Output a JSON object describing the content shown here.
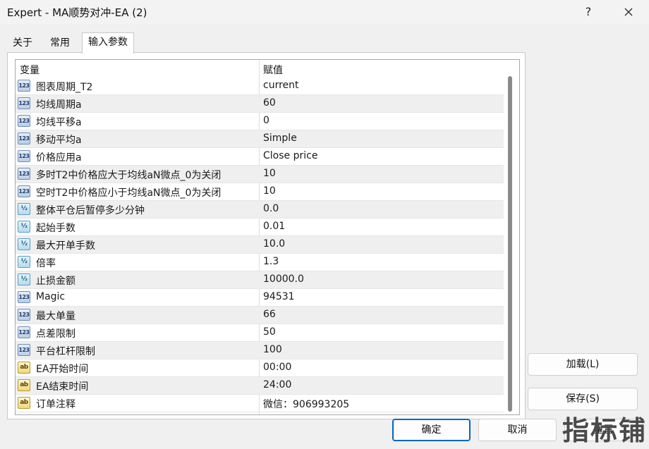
{
  "window": {
    "title": "Expert - MA顺势对冲-EA (2)",
    "help_label": "?"
  },
  "tabs": [
    {
      "label": "关于",
      "active": false
    },
    {
      "label": "常用",
      "active": false
    },
    {
      "label": "输入参数",
      "active": true
    }
  ],
  "table": {
    "headers": {
      "variable": "变量",
      "value": "赋值"
    },
    "rows": [
      {
        "icon": "int",
        "icon_text": "123",
        "name": "图表周期_T2",
        "value": "current"
      },
      {
        "icon": "int",
        "icon_text": "123",
        "name": "均线周期a",
        "value": "60"
      },
      {
        "icon": "int",
        "icon_text": "123",
        "name": "均线平移a",
        "value": "0"
      },
      {
        "icon": "int",
        "icon_text": "123",
        "name": "移动平均a",
        "value": "Simple"
      },
      {
        "icon": "int",
        "icon_text": "123",
        "name": "价格应用a",
        "value": "Close price"
      },
      {
        "icon": "int",
        "icon_text": "123",
        "name": "多时T2中价格应大于均线aN微点_0为关闭",
        "value": "10"
      },
      {
        "icon": "int",
        "icon_text": "123",
        "name": "空时T2中价格应小于均线aN微点_0为关闭",
        "value": "10"
      },
      {
        "icon": "double",
        "icon_text": "½",
        "name": "整体平仓后暂停多少分钟",
        "value": "0.0"
      },
      {
        "icon": "double",
        "icon_text": "½",
        "name": "起始手数",
        "value": "0.01"
      },
      {
        "icon": "double",
        "icon_text": "½",
        "name": "最大开单手数",
        "value": "10.0"
      },
      {
        "icon": "double",
        "icon_text": "½",
        "name": "倍率",
        "value": "1.3"
      },
      {
        "icon": "double",
        "icon_text": "½",
        "name": "止损金额",
        "value": "10000.0"
      },
      {
        "icon": "int",
        "icon_text": "123",
        "name": "Magic",
        "value": "94531"
      },
      {
        "icon": "int",
        "icon_text": "123",
        "name": "最大单量",
        "value": "66"
      },
      {
        "icon": "int",
        "icon_text": "123",
        "name": "点差限制",
        "value": "50"
      },
      {
        "icon": "int",
        "icon_text": "123",
        "name": "平台杠杆限制",
        "value": "100"
      },
      {
        "icon": "string",
        "icon_text": "ab",
        "name": "EA开始时间",
        "value": "00:00"
      },
      {
        "icon": "string",
        "icon_text": "ab",
        "name": "EA结束时间",
        "value": "24:00"
      },
      {
        "icon": "string",
        "icon_text": "ab",
        "name": "订单注释",
        "value": "微信：906993205"
      }
    ]
  },
  "buttons": {
    "load": "加载(L)",
    "save": "保存(S)",
    "ok": "确定",
    "cancel": "取消",
    "reset": "重置"
  },
  "watermark": "指标铺",
  "colors": {
    "accent": "#0067c0",
    "alt_row": "#efefef"
  }
}
